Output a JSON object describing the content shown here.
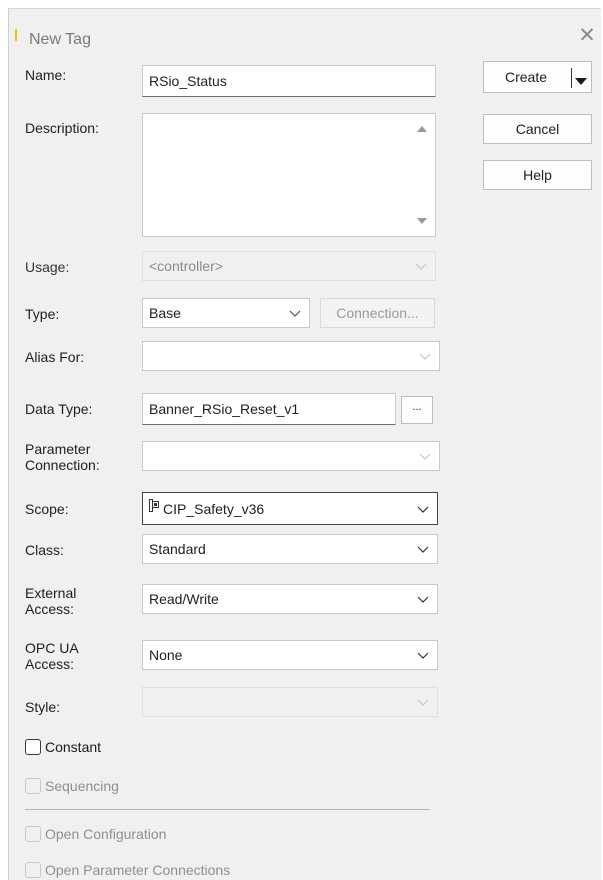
{
  "window": {
    "title": "New Tag",
    "close_glyph": "✕"
  },
  "buttons": {
    "create": "Create",
    "create_arrow": "▾",
    "cancel": "Cancel",
    "help": "Help",
    "connection": "Connection...",
    "datatype_browse": "..."
  },
  "fields": {
    "name": {
      "label": "Name:",
      "value": "RSio_Status"
    },
    "description": {
      "label": "Description:",
      "value": ""
    },
    "usage": {
      "label": "Usage:",
      "value": "<controller>"
    },
    "type": {
      "label": "Type:",
      "value": "Base"
    },
    "alias_for": {
      "label": "Alias For:",
      "value": ""
    },
    "data_type": {
      "label": "Data Type:",
      "value": "Banner_RSio_Reset_v1"
    },
    "parameter_connection": {
      "label_line1": "Parameter",
      "label_line2": "Connection:",
      "value": ""
    },
    "scope": {
      "label": "Scope:",
      "value": "CIP_Safety_v36",
      "icon": "controller-icon"
    },
    "class": {
      "label": "Class:",
      "value": "Standard"
    },
    "external_access": {
      "label_line1": "External",
      "label_line2": "Access:",
      "value": "Read/Write"
    },
    "opc_ua_access": {
      "label_line1": "OPC UA",
      "label_line2": "Access:",
      "value": "None"
    },
    "style": {
      "label": "Style:",
      "value": ""
    }
  },
  "checkboxes": {
    "constant": {
      "label": "Constant",
      "checked": false,
      "enabled": true
    },
    "sequencing": {
      "label": "Sequencing",
      "checked": false,
      "enabled": false
    },
    "open_configuration": {
      "label": "Open Configuration",
      "checked": false,
      "enabled": false
    },
    "open_parameter_connections": {
      "label": "Open Parameter Connections",
      "checked": false,
      "enabled": false
    }
  },
  "colors": {
    "dialog_bg": "#f0f0f0",
    "accent_yellow": "#e8c800",
    "disabled_text": "#8a8a8a"
  }
}
